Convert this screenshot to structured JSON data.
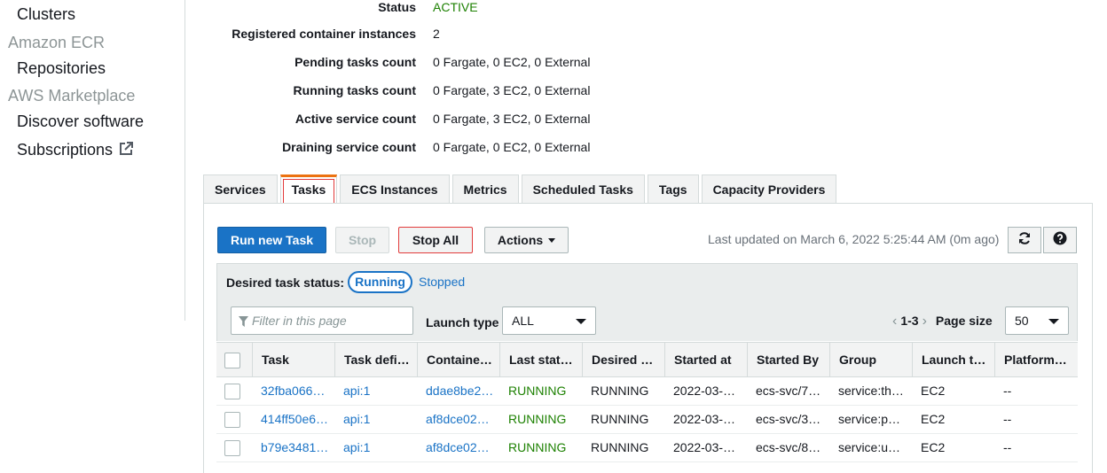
{
  "sidebar": {
    "clusters": "Clusters",
    "ecr_section": "Amazon ECR",
    "repositories": "Repositories",
    "marketplace_section": "AWS Marketplace",
    "discover": "Discover software",
    "subscriptions": "Subscriptions"
  },
  "details": [
    {
      "label": "Status",
      "value": "ACTIVE"
    },
    {
      "label": "Registered container instances",
      "value": "2"
    },
    {
      "label": "Pending tasks count",
      "value": "0 Fargate, 0 EC2, 0 External"
    },
    {
      "label": "Running tasks count",
      "value": "0 Fargate, 3 EC2, 0 External"
    },
    {
      "label": "Active service count",
      "value": "0 Fargate, 3 EC2, 0 External"
    },
    {
      "label": "Draining service count",
      "value": "0 Fargate, 0 EC2, 0 External"
    }
  ],
  "tabs": [
    "Services",
    "Tasks",
    "ECS Instances",
    "Metrics",
    "Scheduled Tasks",
    "Tags",
    "Capacity Providers"
  ],
  "toolbar": {
    "run_new_task": "Run new Task",
    "stop": "Stop",
    "stop_all": "Stop All",
    "actions": "Actions",
    "last_updated": "Last updated on March 6, 2022 5:25:44 AM (0m ago)"
  },
  "filters": {
    "desired_status_label": "Desired task status:",
    "running": "Running",
    "stopped": "Stopped",
    "filter_placeholder": "Filter in this page",
    "launch_type_label": "Launch type",
    "launch_type_value": "ALL",
    "range": "1-3",
    "page_size_label": "Page size",
    "page_size_value": "50"
  },
  "table": {
    "columns": [
      "Task",
      "Task defi…",
      "Containe…",
      "Last stat…",
      "Desired …",
      "Started at",
      "Started By",
      "Group",
      "Launch t…",
      "Platform …"
    ],
    "rows": [
      [
        "32fba066…",
        "api:1",
        "ddae8be2…",
        "RUNNING",
        "RUNNING",
        "2022-03-…",
        "ecs-svc/7…",
        "service:th…",
        "EC2",
        "--"
      ],
      [
        "414ff50e6…",
        "api:1",
        "af8dce02…",
        "RUNNING",
        "RUNNING",
        "2022-03-…",
        "ecs-svc/3…",
        "service:p…",
        "EC2",
        "--"
      ],
      [
        "b79e3481…",
        "api:1",
        "af8dce02…",
        "RUNNING",
        "RUNNING",
        "2022-03-…",
        "ecs-svc/8…",
        "service:u…",
        "EC2",
        "--"
      ]
    ]
  }
}
